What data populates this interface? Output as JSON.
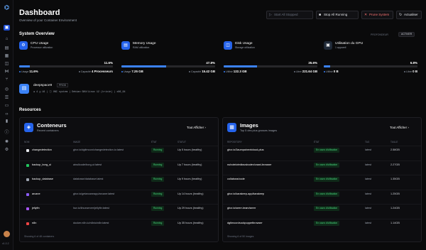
{
  "sidebar": {
    "logo": "⌬",
    "version": "v1.0.2",
    "icons": [
      {
        "name": "panel-icon",
        "glyph": "▣",
        "active": true
      },
      {
        "name": "home-icon",
        "glyph": "⌂"
      },
      {
        "name": "folder-icon",
        "glyph": "▤"
      },
      {
        "name": "image-icon",
        "glyph": "▦"
      },
      {
        "name": "database-icon",
        "glyph": "◫"
      },
      {
        "name": "network-icon",
        "glyph": "⋈"
      },
      {
        "name": "git-icon",
        "glyph": "⑂"
      },
      {
        "name": "globe-icon",
        "glyph": "◎"
      },
      {
        "name": "stack-icon",
        "glyph": "☰"
      },
      {
        "name": "server-icon",
        "glyph": "▭"
      },
      {
        "name": "code-icon",
        "glyph": "‹›"
      },
      {
        "name": "terminal-icon",
        "glyph": "▮"
      },
      {
        "name": "info-icon",
        "glyph": "ⓘ"
      },
      {
        "name": "sun-icon",
        "glyph": "✺"
      },
      {
        "name": "settings-icon",
        "glyph": "⚙"
      }
    ]
  },
  "header": {
    "title": "Dashboard",
    "subtitle": "Overview of your Container Environment",
    "start_all": "Start All Stopped",
    "stop_all": "Stop All Running",
    "prune": "Prune System",
    "refresh": "Actualiser"
  },
  "overview": {
    "label": "System Overview",
    "right_label": "PROFONDEUR",
    "right_button": "ACTIVER",
    "cards": [
      {
        "title": "CPU Usage",
        "sub": "Processor utilization",
        "icon": "⚙",
        "pct": "11.6%",
        "fill": 0.116,
        "l_label": "Usage",
        "l_val": "11.6%",
        "r_label": "Capacité",
        "r_val": "4 Processeurs"
      },
      {
        "title": "Memory Usage",
        "sub": "RAM utilization",
        "icon": "▤",
        "pct": "47.8%",
        "fill": 0.478,
        "l_label": "Usage",
        "l_val": "7.25 GB",
        "r_label": "Capacité",
        "r_val": "15.42 GB"
      },
      {
        "title": "Disk Usage",
        "sub": "Storage utilization",
        "sub2": "",
        "icon": "◫",
        "pct": "35.6%",
        "fill": 0.356,
        "l_label": "Utilisé",
        "l_val": "122.3 GB",
        "r_label": "Libre",
        "r_val": "221.64 GB"
      },
      {
        "title": "Utilisation du GPU",
        "sub": "1 appareil",
        "icon": "▣",
        "pct": "6.8%",
        "fill": 0.068,
        "l_label": "Utilisé",
        "l_val": "0 B",
        "r_label": "Libre",
        "r_val": "0 B"
      }
    ]
  },
  "system": {
    "host": "deepspace9",
    "badge": "PROD",
    "meta": "●  4  ◫  16  |  ⓘ  ONI system  |  Debian GNU/Linux 12 (trixie)  |  x86_64"
  },
  "resources": {
    "label": "Resources",
    "containers": {
      "title": "Conteneurs",
      "sub": "Recent containers",
      "see_all": "Tout Afficher",
      "headers": {
        "name": "Nom",
        "image": "Image",
        "state": "État",
        "status": "Statut"
      },
      "rows": [
        {
          "name": "changedetection",
          "image": "ghcr.io/dgtlmoon/changedetection.io:latest",
          "state": "Running",
          "status": "Up 5 hours (healthy)",
          "color": "#e5e7eb"
        },
        {
          "name": "backup_borg_ui",
          "image": "ainullcode/borg-ui:latest",
          "state": "Running",
          "status": "Up 7 hours (healthy)",
          "color": "#22c55e"
        },
        {
          "name": "backup_database",
          "image": "database/database:latest",
          "state": "Running",
          "status": "Up 9 hours (healthy)",
          "color": "#9ca3af"
        },
        {
          "name": "arcane",
          "image": "ghcr.io/getarcaneapp/arcane:latest",
          "state": "Running",
          "status": "Up 14 hours (healthy)",
          "color": "#8b5cf6"
        },
        {
          "name": "jellyfin",
          "image": "lscr.io/linuxserver/jellyfin:latest",
          "state": "Running",
          "status": "Up 29 hours (healthy)",
          "color": "#a855f7"
        },
        {
          "name": "n8n",
          "image": "docker.n8n.io/n8nio/n8n:latest",
          "state": "Running",
          "status": "Up 35 hours (healthy)",
          "color": "#ef4444"
        }
      ],
      "footer": "Showing 6 of 48 containers"
    },
    "images": {
      "title": "Images",
      "sub": "Top 5 des plus grosses images",
      "see_all": "Tout Afficher",
      "headers": {
        "repo": "Repository",
        "state": "État",
        "tag": "Tag",
        "size": "Taille"
      },
      "rows": [
        {
          "repo": "ghcr.io/3aumpa/nextcloud-plus",
          "state": "En cours d'utilisation",
          "tag": "latest",
          "size": "2.58GB"
        },
        {
          "repo": "nuhotelotmiksvsboden/crawl-browser",
          "state": "En cours d'utilisation",
          "tag": "latest",
          "size": "2.27GB"
        },
        {
          "repo": "collabora/code",
          "state": "En cours d'utilisation",
          "tag": "latest",
          "size": "1.35GB"
        },
        {
          "repo": "ghcr.io/karakeep-app/karakeep",
          "state": "En cours d'utilisation",
          "tag": "latest",
          "size": "1.25GB"
        },
        {
          "repo": "ghcr.io/seerr-team/seerr",
          "state": "En cours d'utilisation",
          "tag": "latest",
          "size": "1.24GB"
        },
        {
          "repo": "dgtlmoon/sockpuppetbrowser",
          "state": "En cours d'utilisation",
          "tag": "latest",
          "size": "1.14GB"
        }
      ],
      "footer": "Showing 6 of 50 images"
    }
  }
}
